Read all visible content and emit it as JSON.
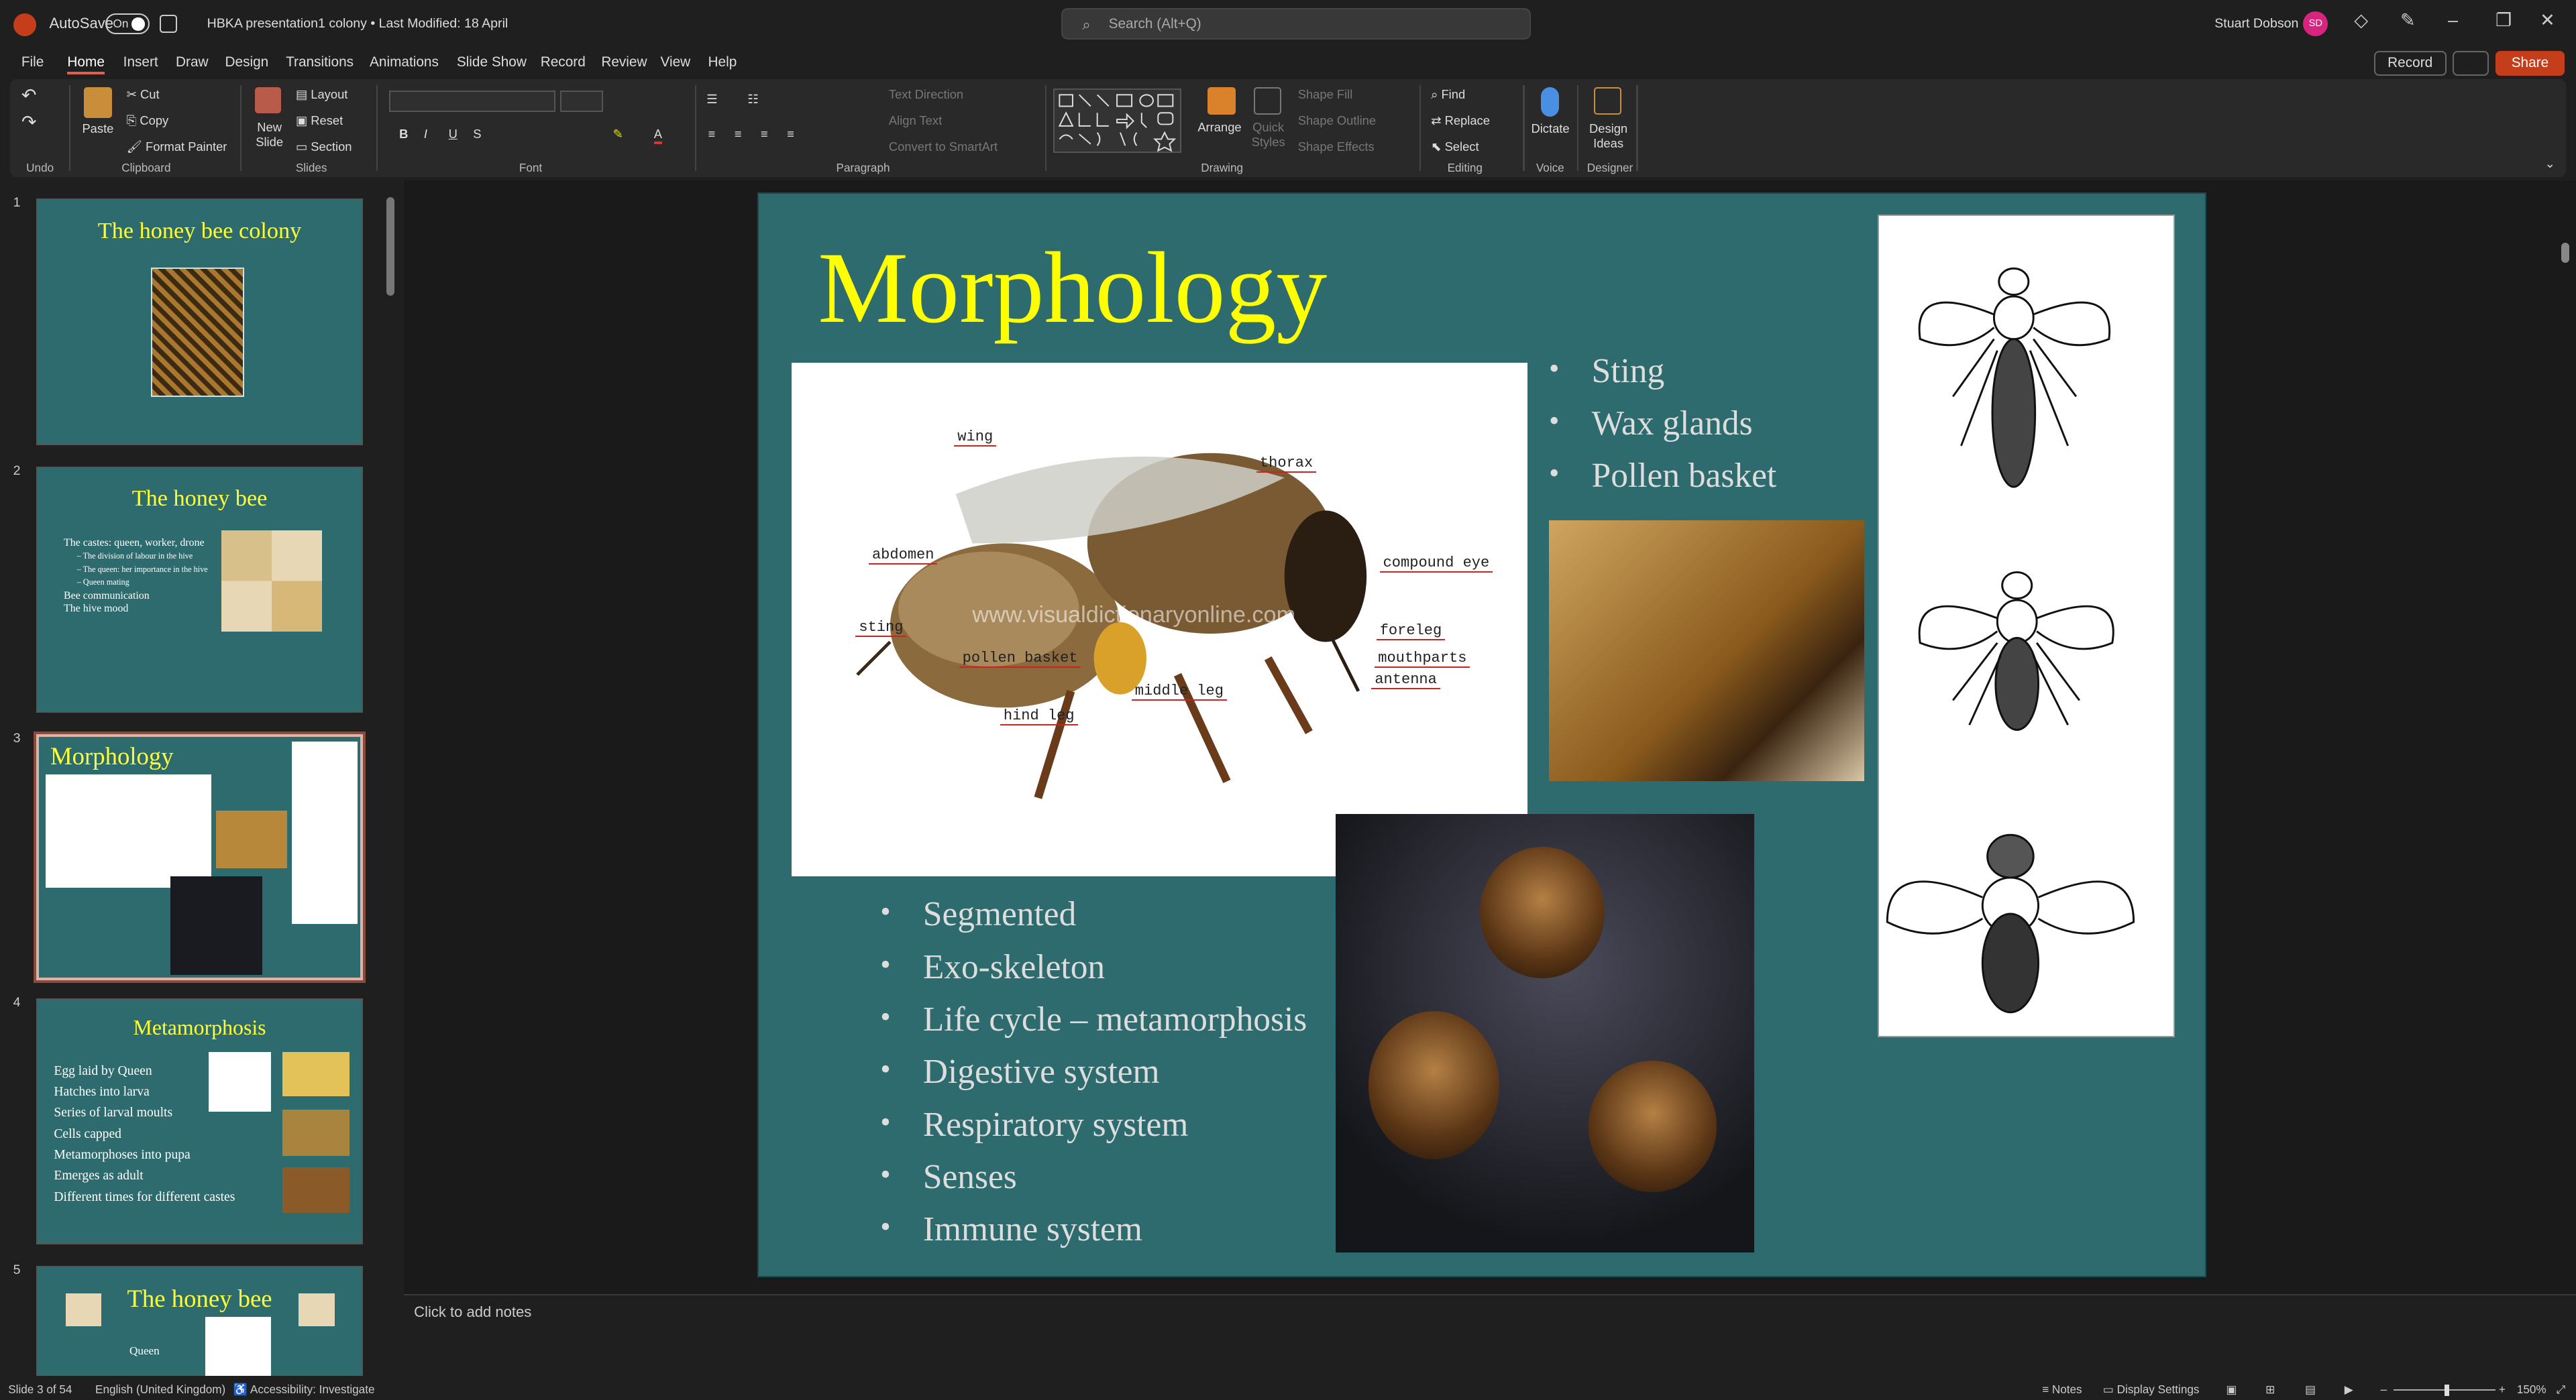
{
  "titlebar": {
    "autosave_label": "AutoSave",
    "autosave_state": "On",
    "doc_title": "HBKA presentation1 colony • Last Modified: 18 April",
    "search_placeholder": "Search (Alt+Q)",
    "user_name": "Stuart Dobson",
    "user_initials": "SD"
  },
  "menu": [
    "File",
    "Home",
    "Insert",
    "Draw",
    "Design",
    "Transitions",
    "Animations",
    "Slide Show",
    "Record",
    "Review",
    "View",
    "Help"
  ],
  "menu_active": "Home",
  "actions": {
    "record": "Record",
    "share": "Share"
  },
  "ribbon": {
    "clipboard": {
      "paste": "Paste",
      "cut": "Cut",
      "copy": "Copy",
      "format_painter": "Format Painter",
      "group": "Clipboard"
    },
    "undo_group": "Undo",
    "slides": {
      "new_slide": "New Slide",
      "layout": "Layout",
      "reset": "Reset",
      "section": "Section",
      "group": "Slides"
    },
    "font_group": "Font",
    "paragraph": {
      "text_direction": "Text Direction",
      "align_text": "Align Text",
      "convert": "Convert to SmartArt",
      "group": "Paragraph"
    },
    "drawing": {
      "arrange": "Arrange",
      "quick_styles": "Quick Styles",
      "shape_fill": "Shape Fill",
      "shape_outline": "Shape Outline",
      "shape_effects": "Shape Effects",
      "group": "Drawing"
    },
    "editing": {
      "find": "Find",
      "replace": "Replace",
      "select": "Select",
      "group": "Editing"
    },
    "voice": {
      "dictate": "Dictate",
      "group": "Voice"
    },
    "designer": {
      "design_ideas": "Design Ideas",
      "group": "Designer"
    }
  },
  "thumbnails": [
    {
      "num": "1",
      "title": "The honey bee colony"
    },
    {
      "num": "2",
      "title": "The honey bee",
      "bullets": [
        "The castes: queen, worker, drone",
        "– The division of labour in the hive",
        "– The queen: her importance in the hive",
        "– Queen mating",
        "Bee communication",
        "The hive mood"
      ]
    },
    {
      "num": "3",
      "title": "Morphology"
    },
    {
      "num": "4",
      "title": "Metamorphosis",
      "bullets": [
        "Egg laid by Queen",
        "Hatches into larva",
        "Series of larval moults",
        "Cells capped",
        "Metamorphoses into pupa",
        "Emerges as adult",
        "Different times for different castes"
      ]
    },
    {
      "num": "5",
      "title": "The honey bee",
      "sub": "Queen"
    }
  ],
  "slide": {
    "title": "Morphology",
    "diagram_labels": [
      "wing",
      "thorax",
      "abdomen",
      "compound eye",
      "sting",
      "foreleg",
      "pollen basket",
      "mouthparts",
      "antenna",
      "middle leg",
      "hind leg"
    ],
    "watermark": "www.visualdictionaryonline.com",
    "right_bullets": [
      "Sting",
      "Wax glands",
      "Pollen basket"
    ],
    "left_bullets": [
      "Segmented",
      "Exo-skeleton",
      "Life cycle – metamorphosis",
      "Digestive system",
      "Respiratory system",
      "Senses",
      "Immune system"
    ]
  },
  "notes_placeholder": "Click to add notes",
  "status": {
    "slide_count": "Slide 3 of 54",
    "language": "English (United Kingdom)",
    "accessibility": "Accessibility: Investigate",
    "notes": "Notes",
    "display_settings": "Display Settings",
    "zoom": "150%"
  },
  "colors": {
    "slide_bg": "#2e6b6e",
    "title": "#ffff00",
    "accent": "#c43e1c"
  }
}
